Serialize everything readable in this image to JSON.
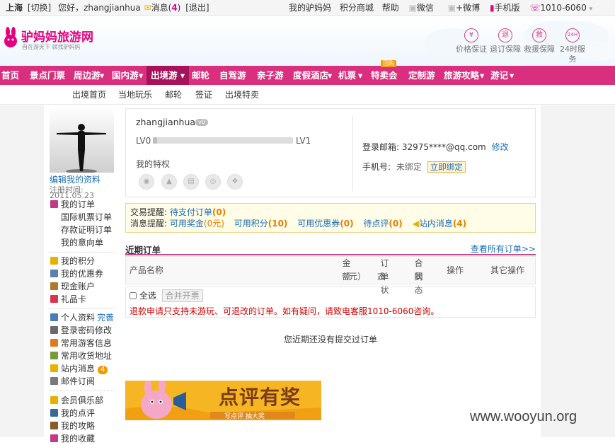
{
  "topbar": {
    "city": "上海",
    "switch": "[切换]",
    "greeting": "您好，",
    "username": "zhangjianhua",
    "messages_label": "消息(",
    "messages_count": "4",
    "messages_close": ")",
    "logout": "[退出]",
    "my_account": "我的驴妈妈",
    "points_mall": "积分商城",
    "help": "帮助",
    "wechat": "微信",
    "weibo": "+微博",
    "mobile": "手机版",
    "phone": "1010-6060"
  },
  "header": {
    "logo_text": "驴妈妈旅游网",
    "logo_slogan": "自在游天下  就找驴妈妈",
    "services": [
      {
        "icon": "yen-icon",
        "glyph": "¥",
        "label": "价格保证"
      },
      {
        "icon": "refund-icon",
        "glyph": "退",
        "label": "退订保障"
      },
      {
        "icon": "rescue-icon",
        "glyph": "救",
        "label": "救援保障"
      },
      {
        "icon": "24h-icon",
        "glyph": "24H",
        "label": "24时服务"
      }
    ]
  },
  "nav": {
    "items": [
      "首页",
      "景点门票",
      "周边游",
      "国内游",
      "出境游",
      "邮轮",
      "自驾游",
      "亲子游",
      "度假酒店",
      "机票",
      "特卖会",
      "定制游",
      "旅游攻略",
      "游记"
    ],
    "active": "出境游",
    "hot_badge": "团购"
  },
  "subnav": {
    "items": [
      "出境首页",
      "当地玩乐",
      "邮轮",
      "签证",
      "出境特卖"
    ]
  },
  "sidebar": {
    "edit_profile": "编辑我的资料",
    "register_label": "注册时间:",
    "register_date": "2011.05.23",
    "groups": [
      [
        {
          "label": "我的订单",
          "icon": "order-icon",
          "color": "#c0398a"
        },
        {
          "label": "国际机票订单",
          "icon": "",
          "color": ""
        },
        {
          "label": "存款证明订单",
          "icon": "",
          "color": ""
        },
        {
          "label": "我的意向单",
          "icon": "",
          "color": ""
        }
      ],
      [
        {
          "label": "我的积分",
          "icon": "points-icon",
          "color": "#e8b100"
        },
        {
          "label": "我的优惠券",
          "icon": "coupon-icon",
          "color": "#5c7fb0"
        },
        {
          "label": "现金账户",
          "icon": "wallet-icon",
          "color": "#b0782a"
        },
        {
          "label": "礼品卡",
          "icon": "giftcard-icon",
          "color": "#d9364f"
        }
      ],
      [
        {
          "label": "个人资料",
          "icon": "profile-icon",
          "color": "#4a7fb5",
          "extra": "完善"
        },
        {
          "label": "登录密码修改",
          "icon": "password-icon",
          "color": "#6a6a6a"
        },
        {
          "label": "常用游客信息",
          "icon": "traveler-icon",
          "color": "#e07a20"
        },
        {
          "label": "常用收货地址",
          "icon": "address-icon",
          "color": "#7a9a3a"
        },
        {
          "label": "站内消息",
          "icon": "message-icon",
          "color": "#e8b100",
          "badge": "4"
        },
        {
          "label": "邮件订阅",
          "icon": "mail-icon",
          "color": "#7a7a7a"
        }
      ],
      [
        {
          "label": "会员俱乐部",
          "icon": "club-icon",
          "color": "#e8b100"
        },
        {
          "label": "我的点评",
          "icon": "review-icon",
          "color": "#3a6a9a"
        },
        {
          "label": "我的攻略",
          "icon": "guide-icon",
          "color": "#8a5a2a"
        },
        {
          "label": "我的收藏",
          "icon": "favorite-icon",
          "color": "#c0398a"
        }
      ]
    ]
  },
  "profile": {
    "username": "zhangjianhua",
    "level_badge": "v0",
    "level_from": "LV0",
    "level_to": "LV1",
    "level_progress": 0.03,
    "privileges_label": "我的特权",
    "privilege_icons": [
      "privilege-1-icon",
      "privilege-2-icon",
      "privilege-3-icon",
      "privilege-4-icon",
      "privilege-5-icon"
    ],
    "email_label": "登录邮箱:",
    "email": "32975****@qq.com",
    "modify": "修改",
    "phone_label": "手机号:",
    "phone_status": "未绑定",
    "bind_now": "立即绑定"
  },
  "notice": {
    "trade_label": "交易提醒:",
    "pending_pay": "待支付订单",
    "pending_pay_count": "(0)",
    "msg_label": "消息提醒:",
    "bonus": "可用奖金",
    "bonus_value": "(0元)",
    "points": "可用积分",
    "points_value": "(10)",
    "coupons": "可用优惠券",
    "coupons_value": "(0)",
    "to_review": "待点评",
    "to_review_value": "(0)",
    "site_msg": "站内消息",
    "site_msg_value": "(4)"
  },
  "orders": {
    "title": "近期订单",
    "view_all": "查看所有订单>>",
    "columns": {
      "product": "产品名称",
      "amount_1": "金额",
      "amount_2": "（元）",
      "status_1": "订单状",
      "status_2": "态",
      "contract_1": "合同",
      "contract_2": "状态",
      "action": "操作",
      "other": "其它操作"
    },
    "select_all": "全选",
    "merge_invoice": "合并开票",
    "refund_notice": "退款申请只支持未游玩、可退改的订单。如有疑问，请致电客服1010-6060咨询。",
    "empty": "您近期还没有提交过订单"
  },
  "banner": {
    "title": "点评有奖",
    "subtitle": "写点评  抽大奖"
  },
  "watermark": "www.wooyun.org"
}
